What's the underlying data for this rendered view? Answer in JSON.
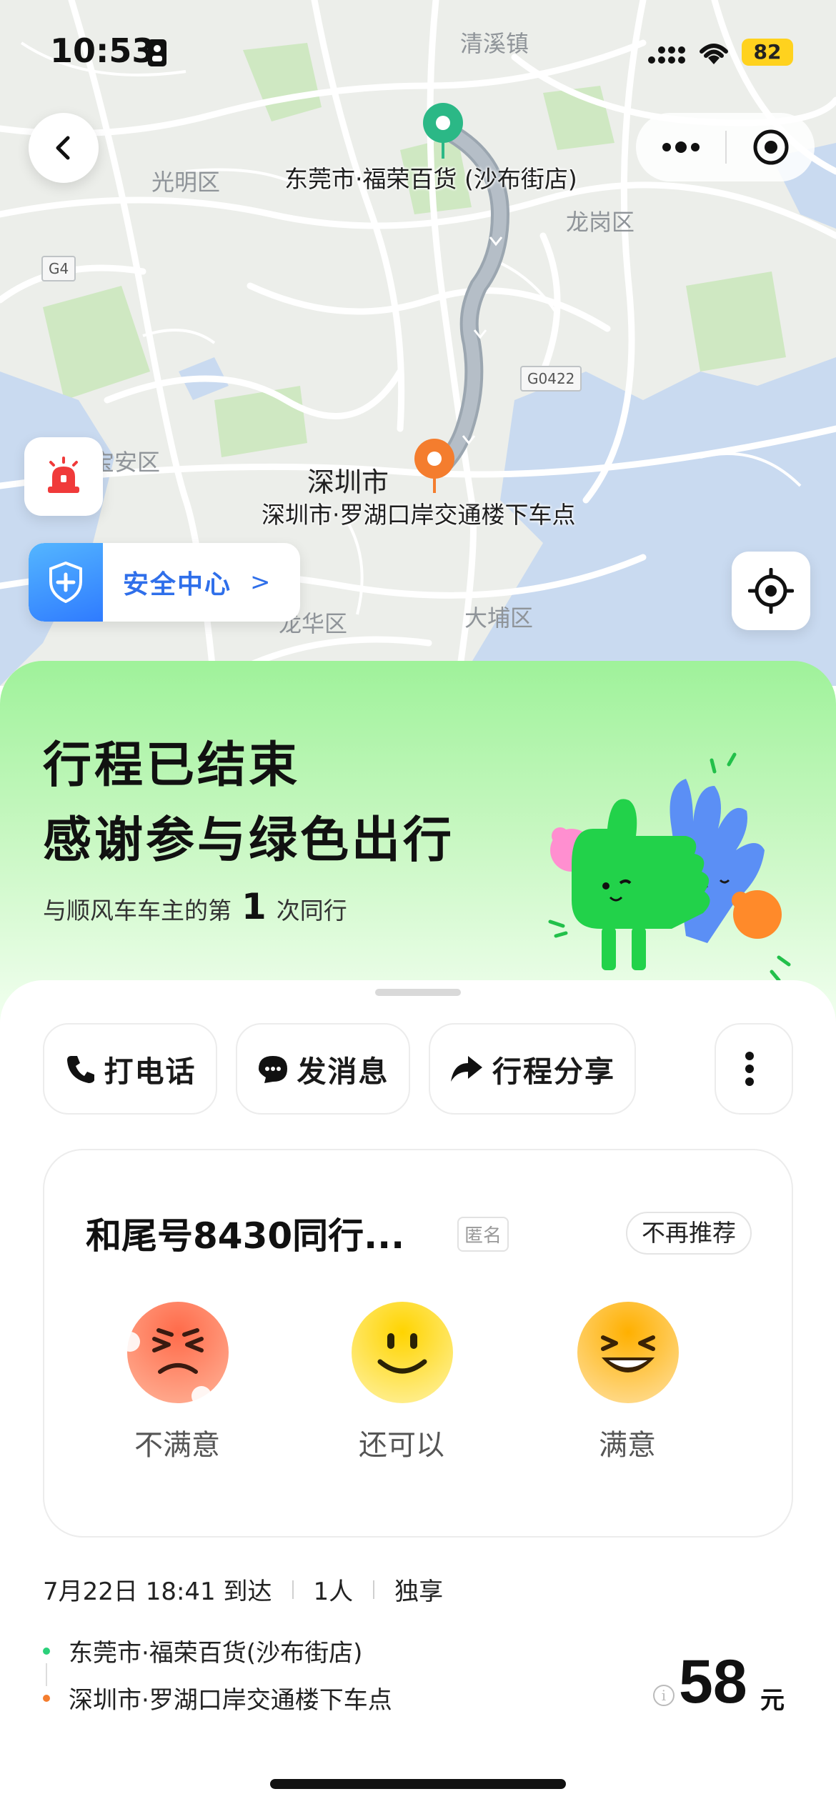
{
  "status_bar": {
    "time": "10:53",
    "battery": "82"
  },
  "map": {
    "labels": {
      "qingxi": "清溪镇",
      "guangming": "光明区",
      "longgang": "龙岗区",
      "baoan": "宝安区",
      "longhua": "龙华区",
      "dapeng": "大埔区",
      "g4": "G4",
      "g0422": "G0422"
    },
    "city_label": "深圳市",
    "origin_label": "东莞市·福荣百货 (沙布街店)",
    "destination_label": "深圳市·罗湖口岸交通楼下车点",
    "safety_center": "安全中心",
    "safety_chevron": ">",
    "colors": {
      "route": "#a9b3bd",
      "origin_pin": "#2bb886",
      "destination_pin": "#f47d2e"
    }
  },
  "header": {
    "title_line1": "行程已结束",
    "title_line2": "感谢参与绿色出行",
    "subtitle_prefix": "与顺风车车主的第",
    "subtitle_count": "1",
    "subtitle_suffix": "次同行"
  },
  "actions": {
    "call": "打电话",
    "message": "发消息",
    "share": "行程分享"
  },
  "rating": {
    "title": "和尾号8430同行...",
    "anonymous_badge": "匿名",
    "no_recommend": "不再推荐",
    "options": [
      "不满意",
      "还可以",
      "满意"
    ]
  },
  "trip": {
    "arrival": "7月22日 18:41 到达",
    "people": "1人",
    "mode": "独享",
    "origin": "东莞市·福荣百货(沙布街店)",
    "destination": "深圳市·罗湖口岸交通楼下车点",
    "price": "58",
    "price_unit": "元",
    "info_icon_glyph": "i"
  },
  "icons": {
    "back": "chevron-left-icon",
    "more": "more-dots-icon",
    "target": "target-icon",
    "alarm": "alarm-icon",
    "shield": "shield-icon",
    "locate": "locate-icon",
    "phone": "phone-icon",
    "message": "message-icon",
    "share": "share-icon",
    "vertical_more": "vertical-dots-icon"
  }
}
